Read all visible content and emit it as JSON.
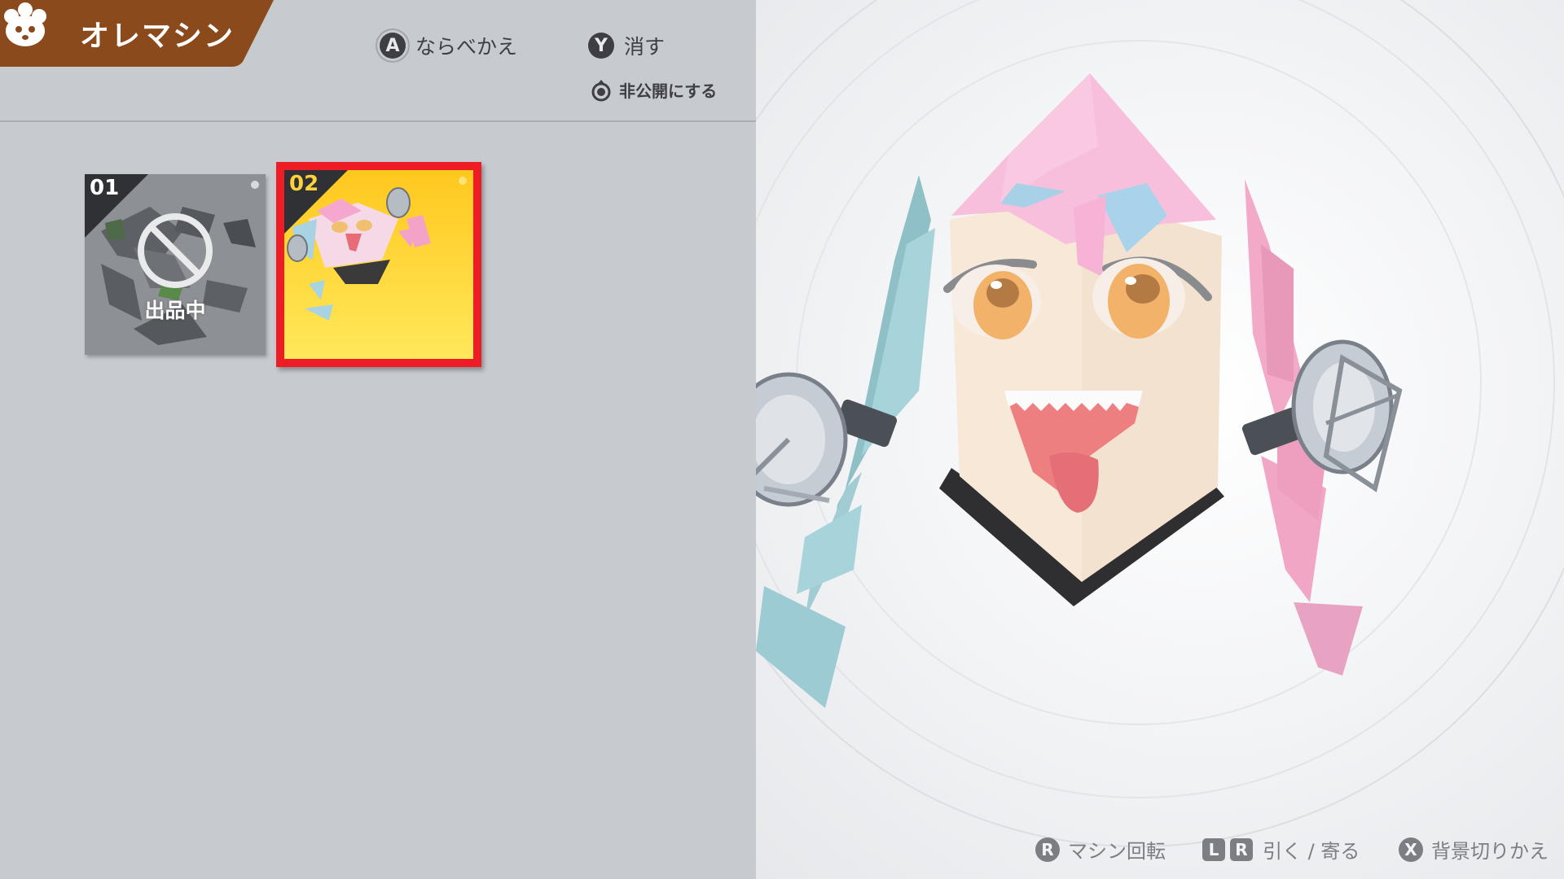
{
  "header": {
    "title": "オレマシン",
    "title_icon": "cat-paw-badge-icon",
    "tab_color": "#8b4a1c"
  },
  "controls": {
    "sort": {
      "button": "A",
      "label": "ならべかえ"
    },
    "delete": {
      "button": "Y",
      "label": "消す"
    },
    "private": {
      "icon": "stick-press-icon",
      "label": "非公開にする"
    }
  },
  "slots": [
    {
      "number": "01",
      "status_label": "出品中",
      "selected": false
    },
    {
      "number": "02",
      "status_label": "",
      "selected": true
    }
  ],
  "footer_hints": {
    "rotate": {
      "button": "R",
      "label": "マシン回転"
    },
    "zoom": {
      "buttons": [
        "L",
        "R"
      ],
      "label": "引く / 寄る"
    },
    "background": {
      "button": "X",
      "label": "背景切りかえ"
    }
  },
  "colors": {
    "selection_border": "#ee1c24",
    "slot_bg_selected": "#ffd23c",
    "slot_bg_listed": "#8d9094"
  }
}
